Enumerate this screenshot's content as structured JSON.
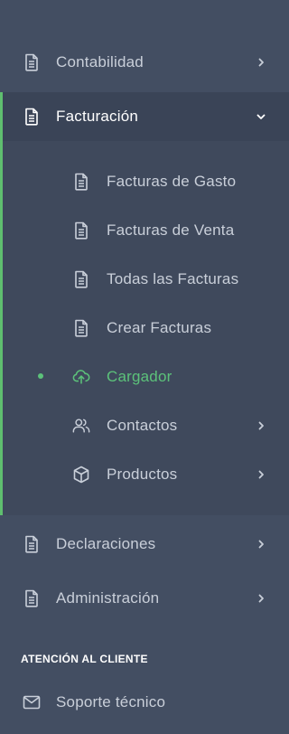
{
  "menu": {
    "contabilidad": {
      "label": "Contabilidad"
    },
    "facturacion": {
      "label": "Facturación"
    },
    "submenu": {
      "gasto": "Facturas de Gasto",
      "venta": "Facturas de Venta",
      "todas": "Todas las Facturas",
      "crear": "Crear Facturas",
      "cargador": "Cargador",
      "contactos": "Contactos",
      "productos": "Productos"
    },
    "declaraciones": {
      "label": "Declaraciones"
    },
    "administracion": {
      "label": "Administración"
    }
  },
  "support": {
    "section_title": "ATENCIÓN AL CLIENTE",
    "soporte": "Soporte técnico"
  },
  "colors": {
    "background": "#434e62",
    "active_row": "#3a4457",
    "submenu_bg": "#3f495c",
    "accent_green": "#5cc27a",
    "text": "#c9cfd9"
  }
}
